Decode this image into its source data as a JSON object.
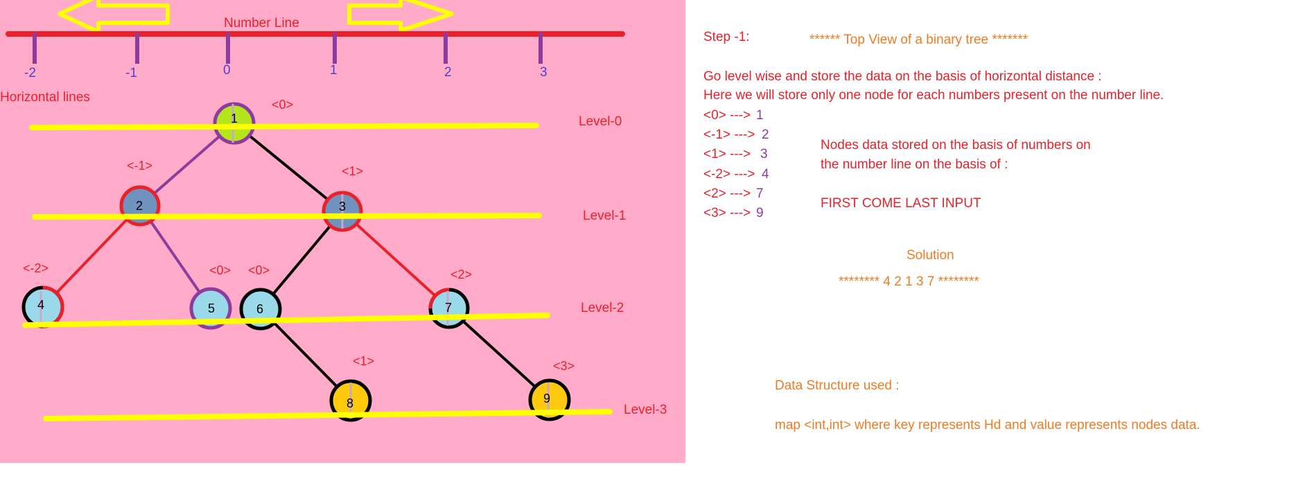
{
  "diagram": {
    "number_line": {
      "title": "Number Line",
      "ticks": [
        "-2",
        "-1",
        "0",
        "1",
        "2",
        "3"
      ]
    },
    "horizontal_lines_label": "Horizontal lines",
    "levels": [
      "Level-0",
      "Level-1",
      "Level-2",
      "Level-3"
    ],
    "nodes": [
      {
        "id": "1",
        "hd": "<0>"
      },
      {
        "id": "2",
        "hd": "<-1>"
      },
      {
        "id": "3",
        "hd": "<1>"
      },
      {
        "id": "4",
        "hd": "<-2>"
      },
      {
        "id": "5",
        "hd": "<0>"
      },
      {
        "id": "6",
        "hd": "<0>"
      },
      {
        "id": "7",
        "hd": "<2>"
      },
      {
        "id": "8",
        "hd": "<1>"
      },
      {
        "id": "9",
        "hd": "<3>"
      }
    ],
    "colors": {
      "panel_bg": "#ffabc9",
      "number_line": "#e8212b",
      "tick": "#8e3b9e",
      "level_line": "#ffff00",
      "arrow_outline": "#ffff00",
      "node_root": "#b5e61d",
      "node_steel": "#7092be",
      "node_light_blue": "#99d9ea",
      "node_gold": "#ffc90e",
      "text_red": "#e8212b",
      "text_orange": "#f07b24",
      "text_purple": "#8e3b9e"
    }
  },
  "notes": {
    "step": "Step -1:",
    "heading": "****** Top View of a binary tree *******",
    "line1": "Go level wise and store the data on the basis of horizontal distance :",
    "line2": "Here we will store only one node for  each numbers present on the number line.",
    "map_entries": [
      {
        "key": "<0> --->",
        "value": "1"
      },
      {
        "key": "<-1> --->",
        "value": "2"
      },
      {
        "key": "<1> --->",
        "value": "3"
      },
      {
        "key": "<-2> --->",
        "value": "4"
      },
      {
        "key": "<2> --->",
        "value": "7"
      },
      {
        "key": "<3> --->",
        "value": "9"
      }
    ],
    "side_note_line1": "Nodes data stored on the basis of numbers on",
    "side_note_line2": "the number line on the basis of :",
    "rule": "FIRST COME LAST INPUT",
    "solution_label": "Solution",
    "solution_value": "********   4 2 1 3 7 ********",
    "ds_label": "Data Structure used :",
    "ds_value": "map <int,int> where key represents Hd and value represents nodes data."
  }
}
